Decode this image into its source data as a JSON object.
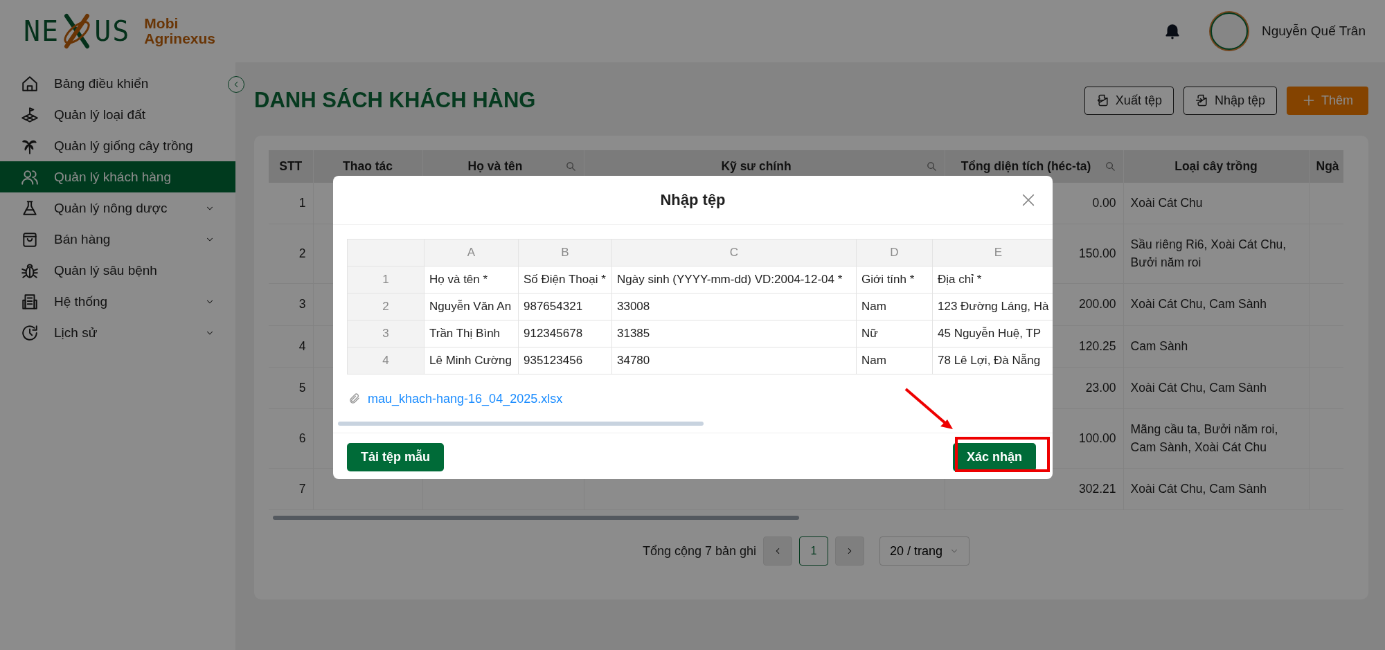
{
  "header": {
    "logo": {
      "left": "NE",
      "right": "US"
    },
    "brand_line_1": "Mobi",
    "brand_line_2": "Agrinexus",
    "user_name": "Nguyễn Quế Trân"
  },
  "sidebar": {
    "items": [
      {
        "label": "Bảng điều khiển",
        "selected": false,
        "expandable": false
      },
      {
        "label": "Quản lý loại đất",
        "selected": false,
        "expandable": false
      },
      {
        "label": "Quản lý giống cây trồng",
        "selected": false,
        "expandable": false
      },
      {
        "label": "Quản lý khách hàng",
        "selected": true,
        "expandable": false
      },
      {
        "label": "Quản lý nông dược",
        "selected": false,
        "expandable": true
      },
      {
        "label": "Bán hàng",
        "selected": false,
        "expandable": true
      },
      {
        "label": "Quản lý sâu bệnh",
        "selected": false,
        "expandable": false
      },
      {
        "label": "Hệ thống",
        "selected": false,
        "expandable": true
      },
      {
        "label": "Lịch sử",
        "selected": false,
        "expandable": true
      }
    ]
  },
  "page": {
    "title": "DANH SÁCH KHÁCH HÀNG",
    "actions": [
      {
        "label": "Xuất tệp",
        "kind": "outline"
      },
      {
        "label": "Nhập tệp",
        "kind": "outline"
      },
      {
        "label": "Thêm",
        "kind": "primary"
      }
    ],
    "table": {
      "columns": [
        {
          "label": "STT",
          "searchable": false
        },
        {
          "label": "Thao tác",
          "searchable": false
        },
        {
          "label": "Họ và tên",
          "searchable": true
        },
        {
          "label": "Kỹ sư chính",
          "searchable": true
        },
        {
          "label": "Tổng diện tích (héc-ta)",
          "searchable": true
        },
        {
          "label": "Loại cây trồng",
          "searchable": false
        },
        {
          "label": "Ngà",
          "searchable": false
        }
      ],
      "rows": [
        {
          "stt": "1",
          "area": "0.00",
          "crops": "Xoài Cát Chu"
        },
        {
          "stt": "2",
          "area": "150.00",
          "crops": "Sầu riêng Ri6, Xoài Cát Chu, Bưởi năm roi"
        },
        {
          "stt": "3",
          "area": "200.00",
          "crops": "Xoài Cát Chu, Cam Sành"
        },
        {
          "stt": "4",
          "area": "120.25",
          "crops": "Cam Sành"
        },
        {
          "stt": "5",
          "area": "23.00",
          "crops": "Xoài Cát Chu, Cam Sành"
        },
        {
          "stt": "6",
          "area": "100.00",
          "crops": "Mãng cầu ta, Bưởi năm roi, Cam Sành, Xoài Cát Chu"
        },
        {
          "stt": "7",
          "area": "302.21",
          "crops": "Xoài Cát Chu, Cam Sành"
        }
      ]
    },
    "pagination": {
      "total": "Tổng cộng 7 bản ghi",
      "pages": [
        {
          "label": "1",
          "selected": true
        }
      ],
      "page_size": "20 / trang"
    }
  },
  "modal": {
    "title": "Nhập tệp",
    "sheet": {
      "column_letters": [
        "A",
        "B",
        "C",
        "D",
        "E"
      ],
      "rows": [
        {
          "number": "1",
          "cells": [
            "Họ và tên *",
            "Số Điện Thoại *",
            "Ngày sinh (YYYY-mm-dd) VD:2004-12-04 *",
            "Giới tính *",
            "Địa chỉ *"
          ]
        },
        {
          "number": "2",
          "cells": [
            "Nguyễn Văn An",
            "987654321",
            "33008",
            "Nam",
            "123 Đường Láng, Hà"
          ]
        },
        {
          "number": "3",
          "cells": [
            "Trần Thị Bình",
            "912345678",
            "31385",
            "Nữ",
            "45 Nguyễn Huệ, TP"
          ]
        },
        {
          "number": "4",
          "cells": [
            "Lê Minh Cường",
            "935123456",
            "34780",
            "Nam",
            "78 Lê Lợi, Đà Nẵng"
          ]
        }
      ]
    },
    "attachment": "mau_khach-hang-16_04_2025.xlsx",
    "buttons": [
      {
        "label": "Tải tệp mẫu",
        "highlighted": false
      },
      {
        "label": "Xác nhận",
        "highlighted": true
      }
    ]
  }
}
